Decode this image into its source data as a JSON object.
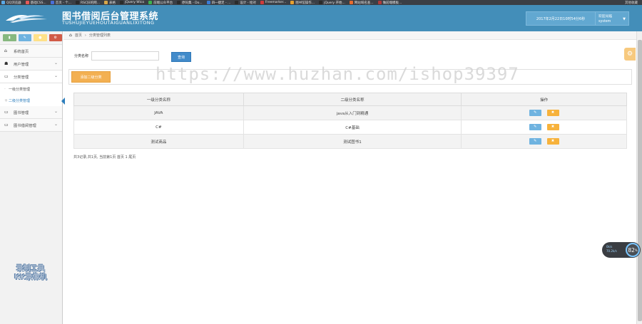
{
  "bookmarks": [
    {
      "label": "QQ浏览器",
      "color": "#5aa9e6"
    },
    {
      "label": "基础CSS...",
      "color": "#e65a5a"
    },
    {
      "label": "首页 - 个...",
      "color": "#4a6fd8"
    },
    {
      "label": "RSC旧的网...",
      "color": "#2a2a2a"
    },
    {
      "label": "表格",
      "color": "#d8a84a"
    },
    {
      "label": "jQuery Wico",
      "color": "#2b2b2b"
    },
    {
      "label": "前端公众平台",
      "color": "#3fb34f"
    },
    {
      "label": "原码集 - Do...",
      "color": "#2b2b2b"
    },
    {
      "label": "四一捷足 - ...",
      "color": "#3a7bd5"
    },
    {
      "label": "设计 - 绘对",
      "color": "#2b2b2b"
    },
    {
      "label": "Freemarker...",
      "color": "#d03b3b"
    },
    {
      "label": "图书馆操作...",
      "color": "#e8a02f"
    },
    {
      "label": "jQuery 开始...",
      "color": "#2b2b2b"
    },
    {
      "label": "网站域名查...",
      "color": "#e86b2f"
    },
    {
      "label": "做前端模板...",
      "color": "#b03b3b"
    }
  ],
  "bookmarks_right": "其他收藏",
  "header": {
    "title": "图书借阅后台管理系统",
    "subtitle": "TUSHUJIEYUEHOUTAIGUANLIXITONG",
    "datetime": "2017年2月22日10时54分6秒",
    "welcome": "欢迎光临",
    "username": "system"
  },
  "shortcuts": [
    {
      "icon": "signal-icon",
      "glyph": "▮",
      "color": "#87b87f"
    },
    {
      "icon": "pencil-icon",
      "glyph": "✎",
      "color": "#6fb3e0"
    },
    {
      "icon": "users-icon",
      "glyph": "●",
      "color": "#fee188"
    },
    {
      "icon": "cogs-icon",
      "glyph": "⚙",
      "color": "#d15b47"
    }
  ],
  "sidebar": {
    "items": [
      {
        "label": "系统首页",
        "icon": "home-icon",
        "glyph": "⌂"
      },
      {
        "label": "用户管理",
        "icon": "users-icon",
        "glyph": "☗"
      },
      {
        "label": "分类管理",
        "icon": "desktop-icon",
        "glyph": "▭"
      },
      {
        "label": "图书管理",
        "icon": "desktop-icon",
        "glyph": "▭"
      },
      {
        "label": "图书借阅管理",
        "icon": "desktop-icon",
        "glyph": "▭"
      }
    ],
    "subitems": [
      {
        "label": "一级分类管理"
      },
      {
        "label": "二级分类管理"
      }
    ]
  },
  "watermark_left": {
    "line1": "录制工具",
    "line2": "KK录像机"
  },
  "breadcrumb": {
    "home": "首页",
    "separator": "›",
    "current": "分类管理列表"
  },
  "search": {
    "label": "分类名称",
    "value": "",
    "button": "查询"
  },
  "add_button": "添加二级分类",
  "table": {
    "headers": [
      "一级分类名称",
      "二级分类名称",
      "操作"
    ],
    "rows": [
      {
        "cat1": "JAVA",
        "cat2": "java从入门到精通"
      },
      {
        "cat1": "C#",
        "cat2": "C#基础"
      },
      {
        "cat1": "测试商品",
        "cat2": "测试图书1"
      }
    ],
    "edit_glyph": "✎",
    "delete_glyph": "✖"
  },
  "pager": "共3记录,共1页, 当前第1页 首页 1 尾页",
  "watermark_center": "https://www.huzhan.com/ishop39397",
  "speed_widget": {
    "up": "0k/s",
    "down": "70.2k/s",
    "value": "82",
    "unit": "%"
  }
}
